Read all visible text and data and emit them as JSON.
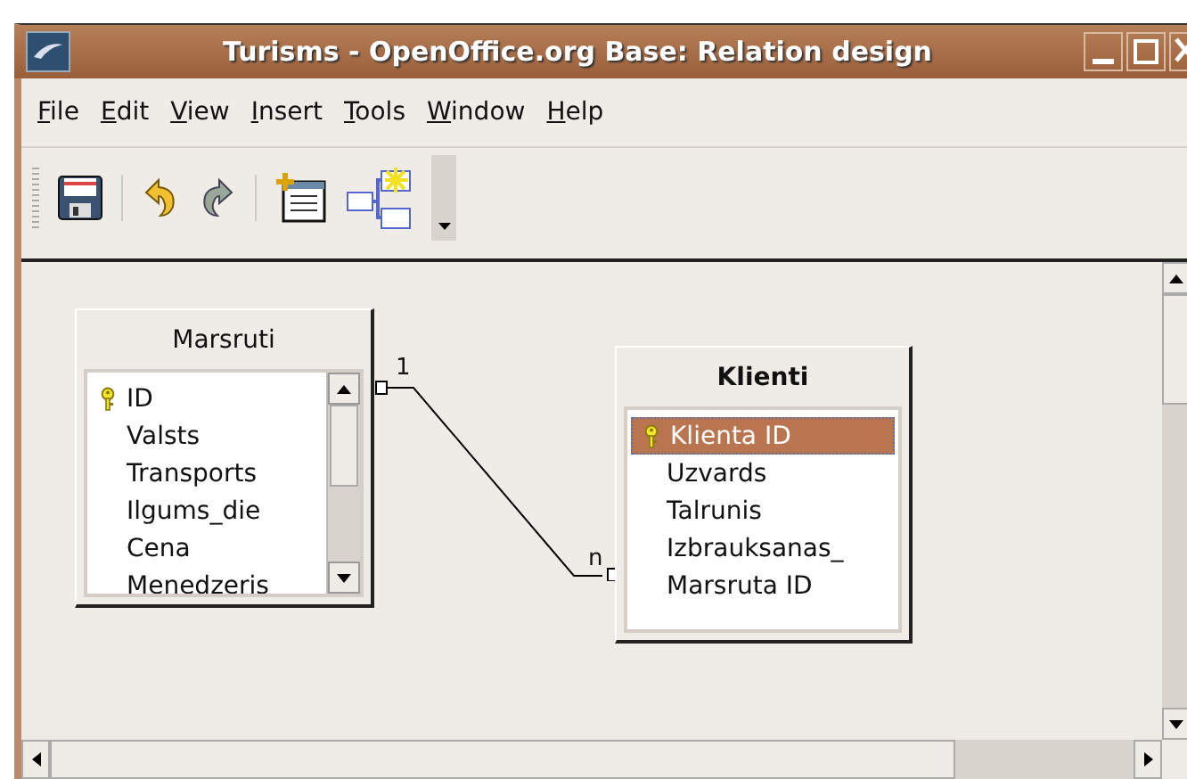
{
  "window": {
    "title": "Turisms - OpenOffice.org Base: Relation design"
  },
  "menu": [
    {
      "label": "File"
    },
    {
      "label": "Edit"
    },
    {
      "label": "View"
    },
    {
      "label": "Insert"
    },
    {
      "label": "Tools"
    },
    {
      "label": "Window"
    },
    {
      "label": "Help"
    }
  ],
  "tables": [
    {
      "title": "Marsruti",
      "active": false,
      "scrollable": true,
      "fields": [
        {
          "name": "ID",
          "primary_key": true,
          "selected": false
        },
        {
          "name": "Valsts",
          "primary_key": false,
          "selected": false
        },
        {
          "name": "Transports",
          "primary_key": false,
          "selected": false
        },
        {
          "name": "Ilgums_die",
          "primary_key": false,
          "selected": false
        },
        {
          "name": "Cena",
          "primary_key": false,
          "selected": false
        },
        {
          "name": "Menedzeris",
          "primary_key": false,
          "selected": false
        }
      ]
    },
    {
      "title": "Klienti",
      "active": true,
      "scrollable": false,
      "fields": [
        {
          "name": "Klienta ID",
          "primary_key": true,
          "selected": true
        },
        {
          "name": "Uzvards",
          "primary_key": false,
          "selected": false
        },
        {
          "name": "Talrunis",
          "primary_key": false,
          "selected": false
        },
        {
          "name": "Izbrauksanas_",
          "primary_key": false,
          "selected": false
        },
        {
          "name": "Marsruta ID",
          "primary_key": false,
          "selected": false
        }
      ]
    }
  ],
  "relation": {
    "from_label": "1",
    "to_label": "n"
  }
}
